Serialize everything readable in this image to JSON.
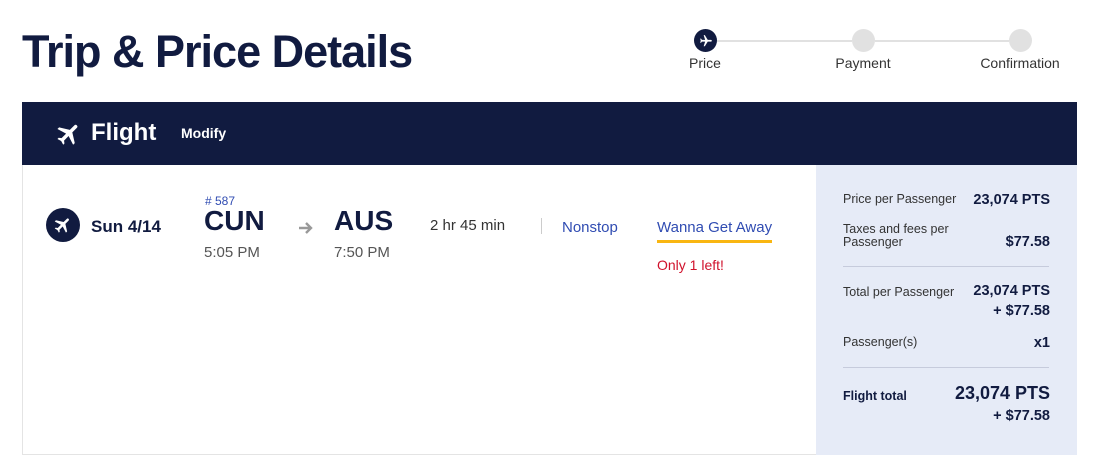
{
  "page": {
    "title": "Trip & Price Details"
  },
  "stepper": {
    "steps": [
      {
        "label": "Price",
        "active": true
      },
      {
        "label": "Payment",
        "active": false
      },
      {
        "label": "Confirmation",
        "active": false
      }
    ]
  },
  "flight_bar": {
    "title": "Flight",
    "modify_label": "Modify",
    "icon": "airplane-icon"
  },
  "flight": {
    "date": "Sun 4/14",
    "flight_number": "# 587",
    "origin": {
      "code": "CUN",
      "time": "5:05 PM"
    },
    "destination": {
      "code": "AUS",
      "time": "7:50 PM"
    },
    "duration": "2 hr 45 min",
    "stops": "Nonstop",
    "fare_type": "Wanna Get Away",
    "seats_left": "Only 1 left!"
  },
  "price": {
    "per_passenger_label": "Price per Passenger",
    "per_passenger_value": "23,074 PTS",
    "taxes_label": "Taxes and fees per Passenger",
    "taxes_value": "$77.58",
    "total_per_passenger_label": "Total per Passenger",
    "total_per_passenger_pts": "23,074 PTS",
    "total_per_passenger_usd": "+ $77.58",
    "passengers_label": "Passenger(s)",
    "passengers_value": "x1",
    "flight_total_label": "Flight total",
    "flight_total_pts": "23,074 PTS",
    "flight_total_usd": "+ $77.58"
  },
  "colors": {
    "navy": "#111b40",
    "link_blue": "#304cb2",
    "gold": "#f9b612",
    "red": "#d0112b",
    "panel": "#e6ebf7"
  }
}
